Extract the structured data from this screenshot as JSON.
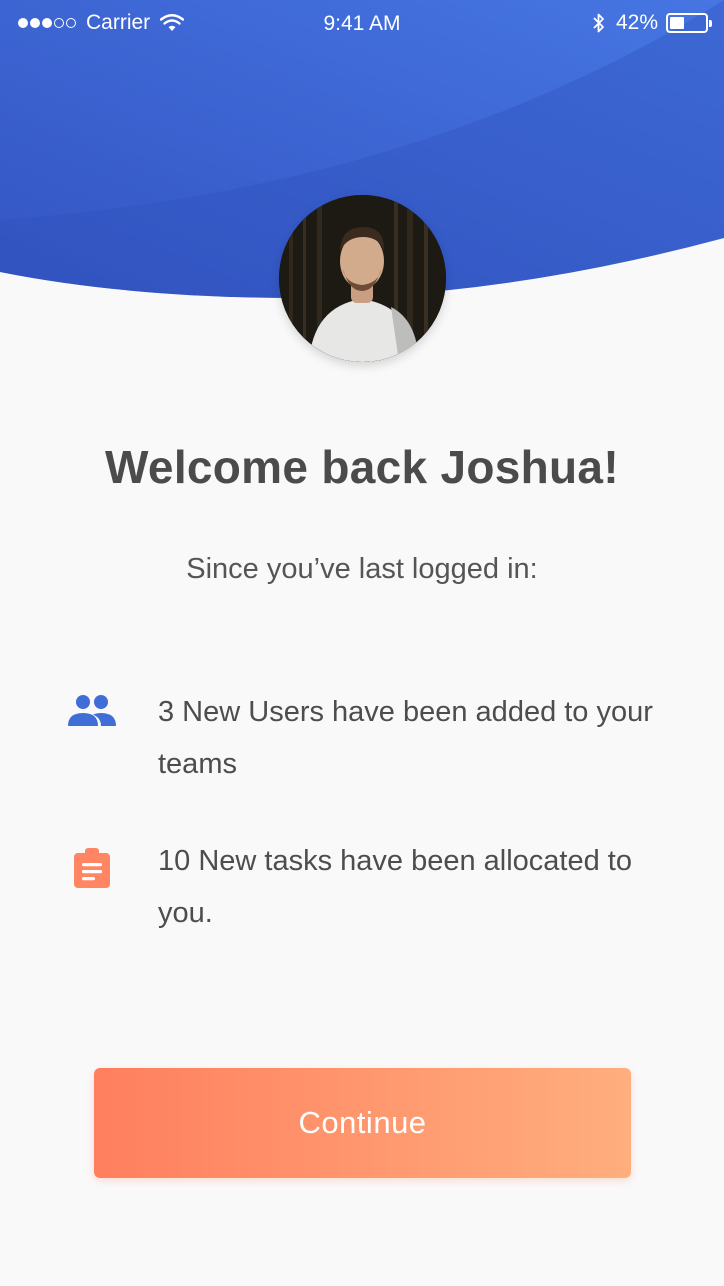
{
  "status_bar": {
    "carrier": "Carrier",
    "time": "9:41 AM",
    "battery_percent": "42%",
    "battery_level": 0.42,
    "signal_bars_filled": 3,
    "signal_bars_total": 5
  },
  "profile": {
    "avatar_icon": "user-photo"
  },
  "welcome": {
    "title": "Welcome back Joshua!",
    "subtitle": "Since you’ve last logged in:"
  },
  "updates": [
    {
      "icon": "people-icon",
      "icon_color": "#3f6fd6",
      "text": "3 New Users have been added to your teams"
    },
    {
      "icon": "clipboard-icon",
      "icon_color": "#ff8563",
      "text": "10 New tasks have been allocated to you."
    }
  ],
  "actions": {
    "continue_label": "Continue"
  },
  "colors": {
    "header_blue": "#3d63d0",
    "accent_orange": "#ff8a66",
    "background": "#f9f9fa"
  }
}
